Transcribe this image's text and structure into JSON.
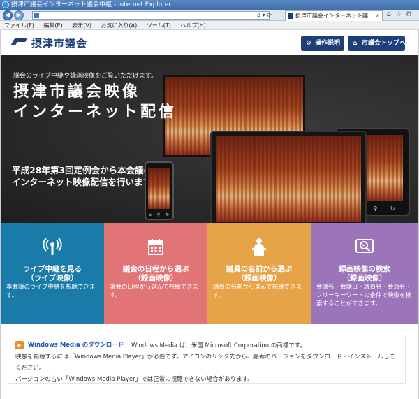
{
  "browser": {
    "window_title": "摂津市議会インターネット議会中継 - Internet Explorer",
    "address_text": "",
    "address_buttons": "ρ ▾ ⟳",
    "tab_title": "摂津市議会インターネット議...",
    "tab_close": "×",
    "menu": [
      "ファイル(F)",
      "編集(E)",
      "表示(V)",
      "お気に入り(A)",
      "ツール(T)",
      "ヘルプ(H)"
    ]
  },
  "header": {
    "logo_text": "摂津市議会",
    "guide_button": "操作説明",
    "top_button": "市議会トップへ"
  },
  "hero": {
    "intro": "議会のライブ中継や録画映像をご覧いただけます。",
    "title_line1": "摂津市議会映像",
    "title_line2": "インターネット配信",
    "sub_line1": "平成28年第3回定例会から本会議の",
    "sub_line2": "インターネット映像配信を行います。"
  },
  "tiles": [
    {
      "icon": "live-antenna-icon",
      "title_line1": "ライブ中継を見る",
      "title_line2": "（ライブ映像）",
      "desc": "本会議のライブ中継を視聴できます。",
      "color": "#1a7ba8"
    },
    {
      "icon": "calendar-icon",
      "title_line1": "議会の日程から選ぶ",
      "title_line2": "（録画映像）",
      "desc": "議会の日程から選んで視聴できます。",
      "color": "#e07477"
    },
    {
      "icon": "speaker-podium-icon",
      "title_line1": "議員の名前から選ぶ",
      "title_line2": "（録画映像）",
      "desc": "議員の名前から選んで視聴できます。",
      "color": "#e7a348"
    },
    {
      "icon": "search-video-icon",
      "title_line1": "録画映像の検索",
      "title_line2": "（録画映像）",
      "desc": "会議名・会議日・議員名・会派名・フリーキーワードの条件で映像を検索することができます。",
      "color": "#9b74b9"
    }
  ],
  "notice": {
    "wmp_label": "Windows Media のダウンロード",
    "line1": "Windows Media は、米国 Microsoft Corporation の商標です。",
    "line2": "映像を視聴するには「Windows Media Player」が必要です。アイコンのリンク先から、最新のバージョンをダウンロード・インストールしてください。",
    "line3": "バージョンの古い「Windows Media Player」では正常に視聴できない場合があります。"
  }
}
